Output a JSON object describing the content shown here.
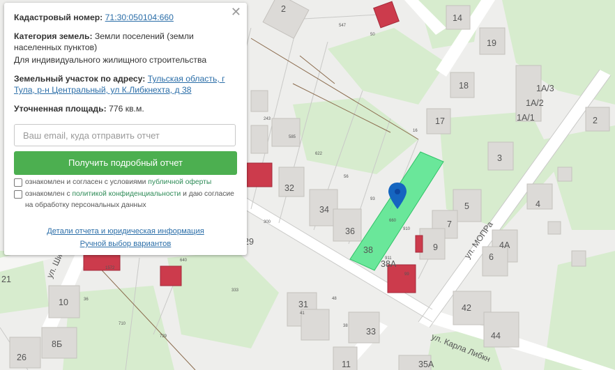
{
  "info_panel": {
    "cadastral_label": "Кадастровый номер:",
    "cadastral_value": "71:30:050104:660",
    "category_label": "Категория земель:",
    "category_value": "Земли поселений (земли населенных пунктов)",
    "usage_value": "Для индивидуального жилищного строительства",
    "address_label": "Земельный участок по адресу:",
    "address_value": "Тульская область, г Тула, р-н Центральный, ул К.Либкнехта, д 38",
    "area_label": "Уточненная площадь:",
    "area_value": "776 кв.м.",
    "email_placeholder": "Ваш email, куда отправить отчет",
    "report_button": "Получить подробный отчет",
    "consent1_prefix": "ознакомлен и согласен с условиями",
    "consent1_link": "публичной оферты",
    "consent2_prefix": "ознакомлен с",
    "consent2_link": "политикой конфиденциальности",
    "consent2_suffix": "и даю согласие на обработку персональных данных",
    "details_link": "Детали отчета и юридическая информация",
    "manual_link": "Ручной выбор вариантов",
    "close_icon": "close-icon"
  },
  "map": {
    "marker_icon": "location-pin-icon",
    "street_labels": [
      "ул. МОПРа",
      "ул. Карла Либкн",
      "ул. Ши"
    ],
    "house_numbers": [
      "2",
      "14",
      "19",
      "1А/3",
      "1А/2",
      "1А/1",
      "18",
      "17",
      "2",
      "3",
      "4",
      "5",
      "4А",
      "6",
      "7",
      "9",
      "42",
      "44",
      "29",
      "21",
      "10",
      "8Б",
      "26",
      "11",
      "35А",
      "31",
      "33",
      "32",
      "34",
      "36",
      "38",
      "38А"
    ],
    "parcel_labels": [
      "547",
      "50",
      "243",
      "585",
      "622",
      "56",
      "16",
      "93",
      "660",
      "910",
      "911",
      "1572",
      "640",
      "710",
      "36",
      "38",
      "41",
      "333",
      "729",
      "48",
      "99",
      "300"
    ],
    "highlight_color": "#3de47f"
  }
}
